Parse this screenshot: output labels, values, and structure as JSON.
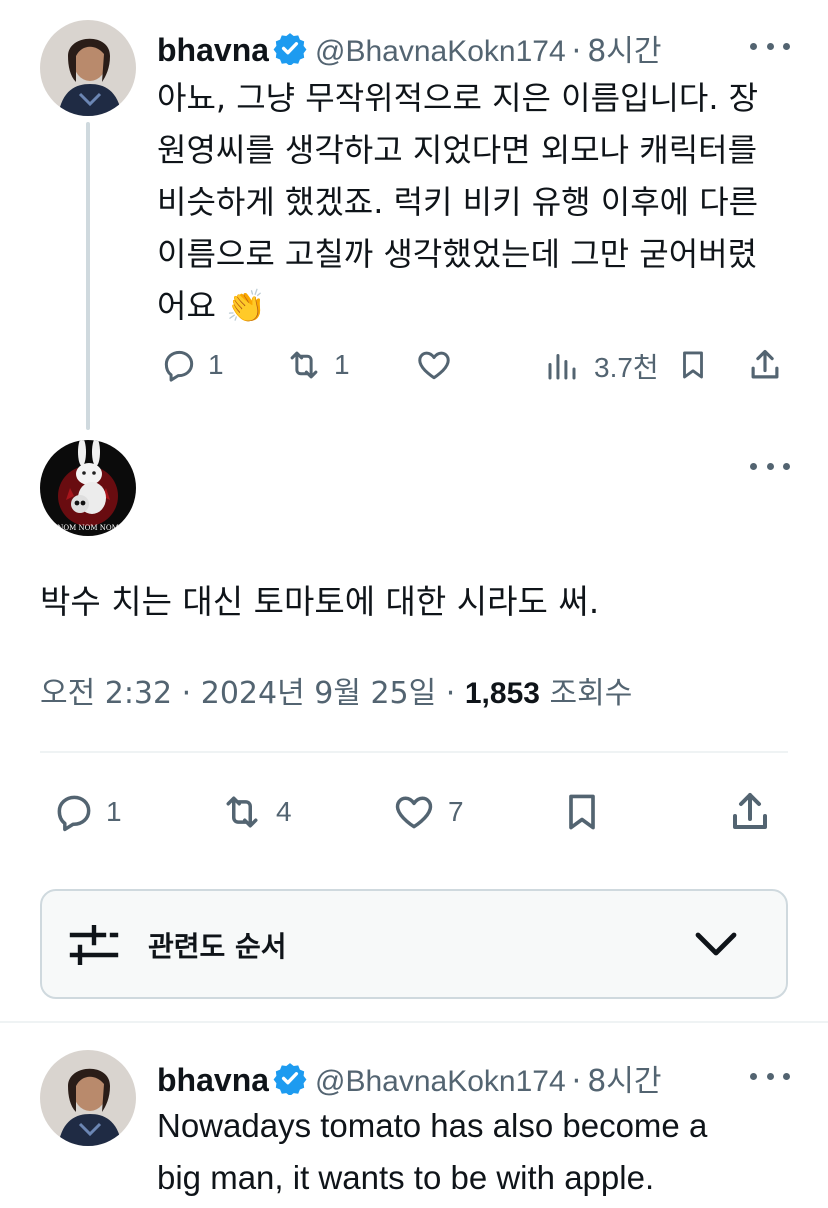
{
  "reply_top": {
    "name": "bhavna",
    "handle": "@BhavnaKokn174",
    "time": "8시간",
    "text_lines": [
      "아뇨, 그냥 무작위적으로 지은 이름입니다. 장",
      "원영씨를 생각하고 지었다면 외모나 캐릭터를",
      "비슷하게 했겠죠. 럭키 비키 유행 이후에 다른",
      "이름으로 고칠까 생각했었는데 그만 굳어버렸",
      "어요 👏"
    ],
    "replies": "1",
    "reposts": "1",
    "likes": "",
    "views": "3.7천"
  },
  "main_tweet": {
    "avatar_caption": "NOM NOM NOM",
    "text": "박수 치는 대신 토마토에 대한 시라도 써.",
    "time": "오전 2:32",
    "date": "2024년 9월 25일",
    "date_sep": "·",
    "views_count": "1,853",
    "views_label": "조회수",
    "replies": "1",
    "reposts": "4",
    "likes": "7"
  },
  "sort": {
    "label": "관련도 순서",
    "icon": "sort-filter-icon",
    "chevron": "chevron-down-icon"
  },
  "reply_bottom": {
    "name": "bhavna",
    "handle": "@BhavnaKokn174",
    "time": "8시간",
    "text_lines": [
      "Nowadays tomato has also become a",
      "big man, it wants to be with apple."
    ]
  },
  "colors": {
    "text_primary": "#0f1419",
    "text_secondary": "#536471",
    "verified_blue": "#1d9bf0",
    "divider": "#eff3f4"
  }
}
